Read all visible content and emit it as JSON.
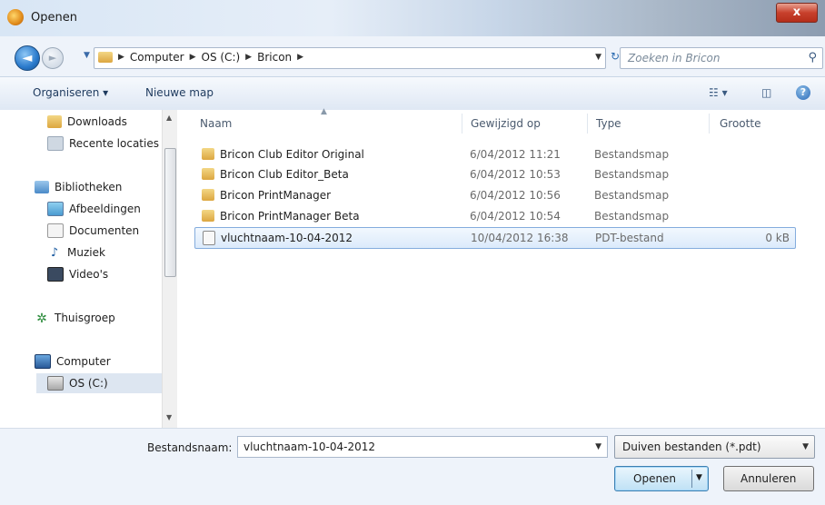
{
  "window": {
    "title": "Openen",
    "close_label": "x"
  },
  "nav": {
    "back_glyph": "◄",
    "forward_glyph": "►",
    "breadcrumbs": [
      "Computer",
      "OS (C:)",
      "Bricon"
    ],
    "breadcrumb_sep": "▶",
    "search_placeholder": "Zoeken in Bricon"
  },
  "toolbar": {
    "organize_label": "Organiseren ▾",
    "new_folder_label": "Nieuwe map",
    "help_label": "?"
  },
  "sidebar": {
    "items": [
      {
        "label": "Downloads",
        "icon": "downloads-folder-icon"
      },
      {
        "label": "Recente locaties",
        "icon": "recent-places-icon"
      },
      {
        "label": "Bibliotheken",
        "icon": "libraries-icon"
      },
      {
        "label": "Afbeeldingen",
        "icon": "pictures-icon"
      },
      {
        "label": "Documenten",
        "icon": "documents-icon"
      },
      {
        "label": "Muziek",
        "icon": "music-icon"
      },
      {
        "label": "Video's",
        "icon": "videos-icon"
      },
      {
        "label": "Thuisgroep",
        "icon": "homegroup-icon"
      },
      {
        "label": "Computer",
        "icon": "computer-icon"
      },
      {
        "label": "OS (C:)",
        "icon": "drive-icon"
      }
    ]
  },
  "filelist": {
    "columns": [
      "Naam",
      "Gewijzigd op",
      "Type",
      "Grootte"
    ],
    "rows": [
      {
        "name": "Bricon Club Editor Original",
        "date": "6/04/2012 11:21",
        "type": "Bestandsmap",
        "size": "",
        "kind": "folder"
      },
      {
        "name": "Bricon Club Editor_Beta",
        "date": "6/04/2012 10:53",
        "type": "Bestandsmap",
        "size": "",
        "kind": "folder"
      },
      {
        "name": "Bricon PrintManager",
        "date": "6/04/2012 10:56",
        "type": "Bestandsmap",
        "size": "",
        "kind": "folder"
      },
      {
        "name": "Bricon PrintManager Beta",
        "date": "6/04/2012 10:54",
        "type": "Bestandsmap",
        "size": "",
        "kind": "folder"
      },
      {
        "name": "vluchtnaam-10-04-2012",
        "date": "10/04/2012 16:38",
        "type": "PDT-bestand",
        "size": "0 kB",
        "kind": "file"
      }
    ]
  },
  "footer": {
    "filename_label": "Bestandsnaam:",
    "filename_value": "vluchtnaam-10-04-2012",
    "filter_value": "Duiven bestanden (*.pdt)",
    "open_label": "Openen",
    "cancel_label": "Annuleren"
  }
}
